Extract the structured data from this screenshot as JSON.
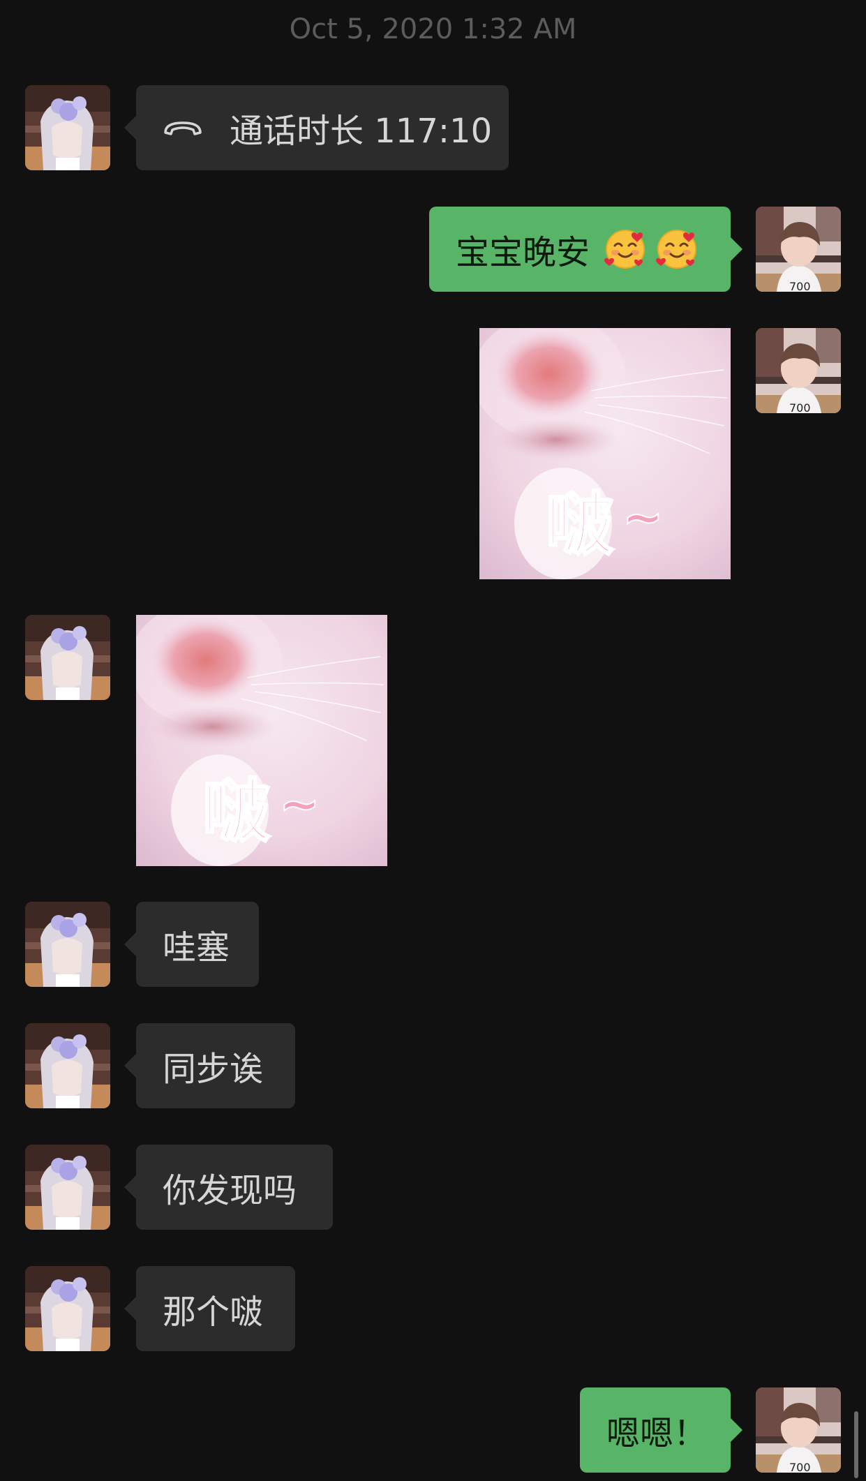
{
  "timestamp": "Oct 5, 2020 1:32 AM",
  "messages": [
    {
      "type": "call",
      "side": "in",
      "text": "通话时长 117:10",
      "icon": "phone-hangup-icon"
    },
    {
      "type": "text",
      "side": "out",
      "text": "宝宝晚安",
      "emoji": [
        "smiling-face-with-hearts",
        "smiling-face-with-hearts"
      ]
    },
    {
      "type": "sticker",
      "side": "out",
      "caption": "啵~"
    },
    {
      "type": "sticker",
      "side": "in",
      "caption": "啵~"
    },
    {
      "type": "text",
      "side": "in",
      "text": "哇塞"
    },
    {
      "type": "text",
      "side": "in",
      "text": "同步诶"
    },
    {
      "type": "text",
      "side": "in",
      "text": "你发现吗"
    },
    {
      "type": "text",
      "side": "in",
      "text": "那个啵"
    },
    {
      "type": "text",
      "side": "out",
      "text": "嗯嗯！"
    }
  ],
  "colors": {
    "background": "#111111",
    "incoming_bubble": "#2c2c2c",
    "outgoing_bubble": "#58b567"
  }
}
